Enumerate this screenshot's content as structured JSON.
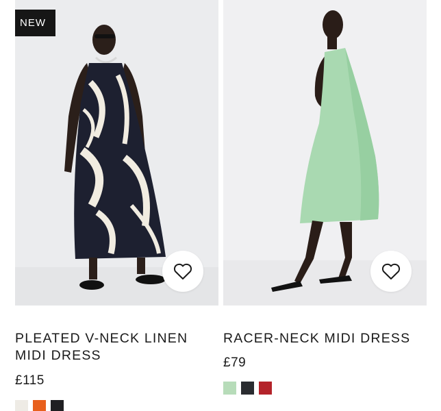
{
  "products": [
    {
      "badge": "NEW",
      "title": "PLEATED V-NECK LINEN MIDI DRESS",
      "price": "£115",
      "wishlist_icon": "heart-icon",
      "swatches": [
        "#eeebe5",
        "#e8601d",
        "#1f1f22"
      ]
    },
    {
      "title": "RACER-NECK MIDI DRESS",
      "price": "£79",
      "wishlist_icon": "heart-icon",
      "swatches": [
        "#b7dcb9",
        "#2a2c30",
        "#b4232a"
      ]
    }
  ],
  "colors": {
    "badge_bg": "#161616",
    "background": "#ffffff",
    "text": "#1a1a1a"
  }
}
